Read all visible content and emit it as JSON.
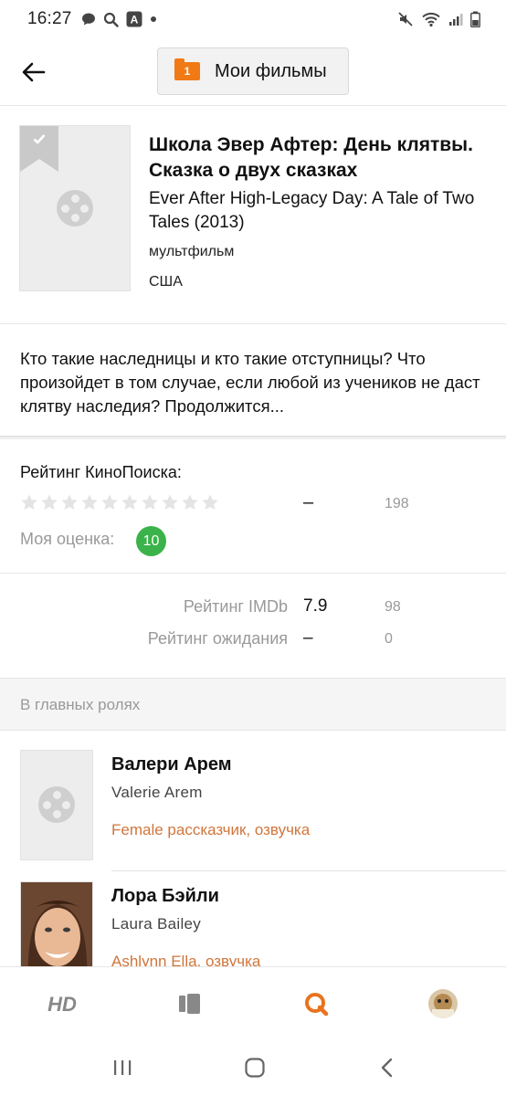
{
  "status_bar": {
    "time": "16:27",
    "left_icons": [
      "chat-bubble-icon",
      "search-icon",
      "translate-app-icon",
      "dot-icon"
    ],
    "right_icons": [
      "mute-icon",
      "wifi-icon",
      "signal-icon",
      "battery-icon"
    ]
  },
  "header": {
    "back_icon": "arrow-left-icon",
    "my_movies_count": "1",
    "my_movies_label": "Мои фильмы"
  },
  "film": {
    "title": "Школа Эвер Афтер: День клятвы. Сказка о двух сказках",
    "original_title": "Ever After High-Legacy Day: A Tale of Two Tales (2013)",
    "genre": "мультфильм",
    "country": "США"
  },
  "description": "Кто такие наследницы и кто такие отступницы? Что произойдет в том случае, если любой из учеников не даст клятву наследия? Продолжится...",
  "kinopoisk": {
    "label": "Рейтинг КиноПоиска:",
    "star_count": 10,
    "value": "–",
    "votes": "198",
    "my_rating_label": "Моя оценка:",
    "my_rating": "10"
  },
  "ratings": {
    "imdb_label": "Рейтинг IMDb",
    "imdb_value": "7.9",
    "imdb_votes": "98",
    "await_label": "Рейтинг ожидания",
    "await_value": "–",
    "await_votes": "0"
  },
  "cast_section": {
    "title": "В главных ролях",
    "items": [
      {
        "name": "Валери Арем",
        "original": "Valerie Arem",
        "role": "Female рассказчик, озвучка"
      },
      {
        "name": "Лора Бэйли",
        "original": "Laura Bailey",
        "role": "Ashlynn Ella, озвучка"
      }
    ]
  },
  "bottom_nav": {
    "items": [
      "hd-icon",
      "library-icon",
      "search-q-icon",
      "profile-avatar"
    ],
    "active_color": "#e8731f"
  },
  "system_nav": [
    "recents-icon",
    "home-icon",
    "back-chevron-icon"
  ]
}
